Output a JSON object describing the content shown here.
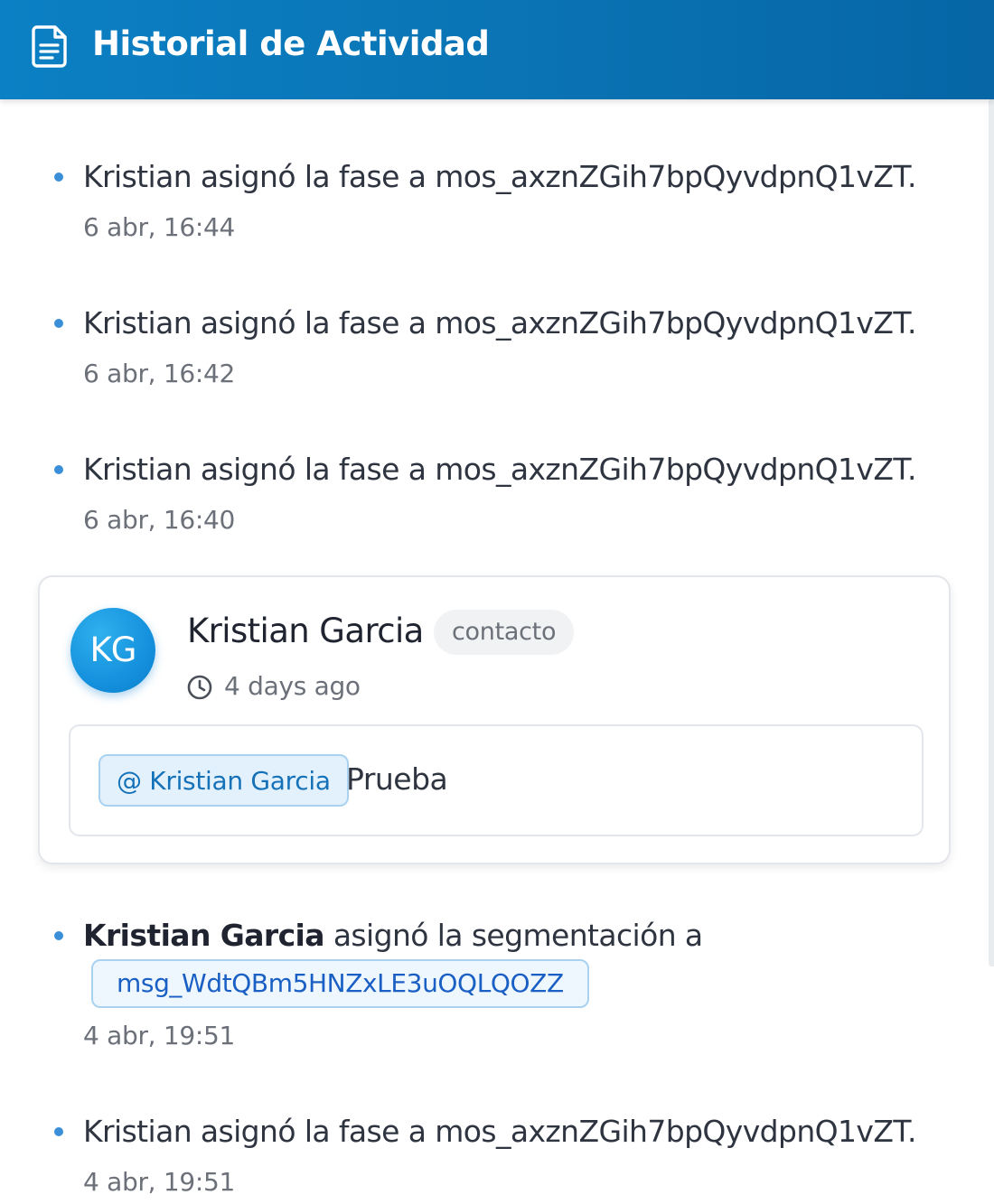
{
  "header": {
    "title": "Historial de Actividad",
    "icon": "document-icon",
    "color": "#0a73b3"
  },
  "activities": [
    {
      "text": "Kristian asignó la fase a mos_axznZGih7bpQyvdpnQ1vZT.",
      "time": "6 abr, 16:44"
    },
    {
      "text": "Kristian asignó la fase a mos_axznZGih7bpQyvdpnQ1vZT.",
      "time": "6 abr, 16:42"
    },
    {
      "text": "Kristian asignó la fase a mos_axznZGih7bpQyvdpnQ1vZT.",
      "time": "6 abr, 16:40"
    }
  ],
  "comment": {
    "avatar_initials": "KG",
    "author": "Kristian Garcia",
    "tag": "contacto",
    "time_icon": "clock-icon",
    "time": "4 days ago",
    "mention": "@ Kristian Garcia",
    "body": "Prueba",
    "avatar_color": "#1591dd"
  },
  "segment_activity": {
    "actor": "Kristian Garcia",
    "action": "asignó la segmentación a",
    "segment_id": "msg_WdtQBm5HNZxLE3uOQLQOZZ",
    "time": "4 abr, 19:51"
  },
  "last_activity": {
    "text": "Kristian asignó la fase a mos_axznZGih7bpQyvdpnQ1vZT.",
    "time": "4 abr, 19:51"
  }
}
